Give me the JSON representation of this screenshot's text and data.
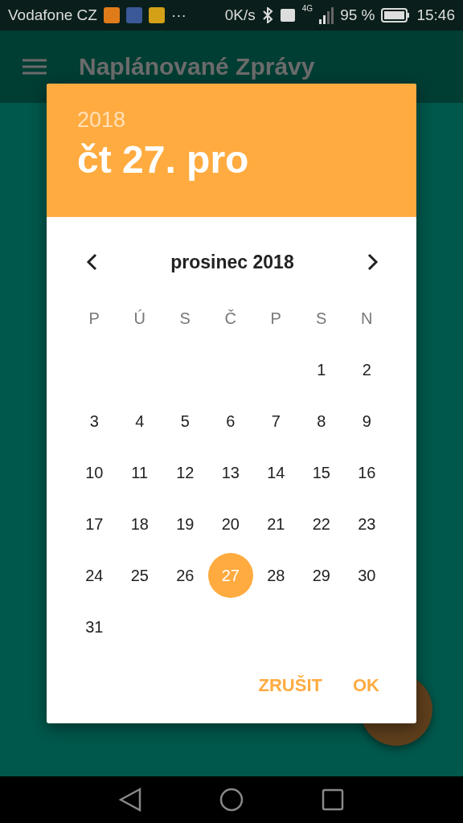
{
  "status_bar": {
    "carrier": "Vodafone CZ",
    "more": "···",
    "speed": "0K/s",
    "network": "4G",
    "battery": "95 %",
    "time": "15:46"
  },
  "app_bar": {
    "title": "Naplánované Zprávy"
  },
  "dialog": {
    "year": "2018",
    "date": "čt 27. pro",
    "month": "prosinec 2018",
    "weekdays": [
      "P",
      "Ú",
      "S",
      "Č",
      "P",
      "S",
      "N"
    ],
    "weeks": [
      [
        {
          "kind": "empty"
        },
        {
          "kind": "empty"
        },
        {
          "kind": "empty"
        },
        {
          "kind": "empty"
        },
        {
          "kind": "empty"
        },
        {
          "kind": "day",
          "label": "1",
          "selected": false
        },
        {
          "kind": "day",
          "label": "2",
          "selected": false
        }
      ],
      [
        {
          "kind": "day",
          "label": "3",
          "selected": false
        },
        {
          "kind": "day",
          "label": "4",
          "selected": false
        },
        {
          "kind": "day",
          "label": "5",
          "selected": false
        },
        {
          "kind": "day",
          "label": "6",
          "selected": false
        },
        {
          "kind": "day",
          "label": "7",
          "selected": false
        },
        {
          "kind": "day",
          "label": "8",
          "selected": false
        },
        {
          "kind": "day",
          "label": "9",
          "selected": false
        }
      ],
      [
        {
          "kind": "day",
          "label": "10",
          "selected": false
        },
        {
          "kind": "day",
          "label": "11",
          "selected": false
        },
        {
          "kind": "day",
          "label": "12",
          "selected": false
        },
        {
          "kind": "day",
          "label": "13",
          "selected": false
        },
        {
          "kind": "day",
          "label": "14",
          "selected": false
        },
        {
          "kind": "day",
          "label": "15",
          "selected": false
        },
        {
          "kind": "day",
          "label": "16",
          "selected": false
        }
      ],
      [
        {
          "kind": "day",
          "label": "17",
          "selected": false
        },
        {
          "kind": "day",
          "label": "18",
          "selected": false
        },
        {
          "kind": "day",
          "label": "19",
          "selected": false
        },
        {
          "kind": "day",
          "label": "20",
          "selected": false
        },
        {
          "kind": "day",
          "label": "21",
          "selected": false
        },
        {
          "kind": "day",
          "label": "22",
          "selected": false
        },
        {
          "kind": "day",
          "label": "23",
          "selected": false
        }
      ],
      [
        {
          "kind": "day",
          "label": "24",
          "selected": false
        },
        {
          "kind": "day",
          "label": "25",
          "selected": false
        },
        {
          "kind": "day",
          "label": "26",
          "selected": false
        },
        {
          "kind": "day",
          "label": "27",
          "selected": true
        },
        {
          "kind": "day",
          "label": "28",
          "selected": false
        },
        {
          "kind": "day",
          "label": "29",
          "selected": false
        },
        {
          "kind": "day",
          "label": "30",
          "selected": false
        }
      ],
      [
        {
          "kind": "day",
          "label": "31",
          "selected": false
        }
      ]
    ],
    "buttons": [
      "ZRUŠIT",
      "OK"
    ]
  }
}
